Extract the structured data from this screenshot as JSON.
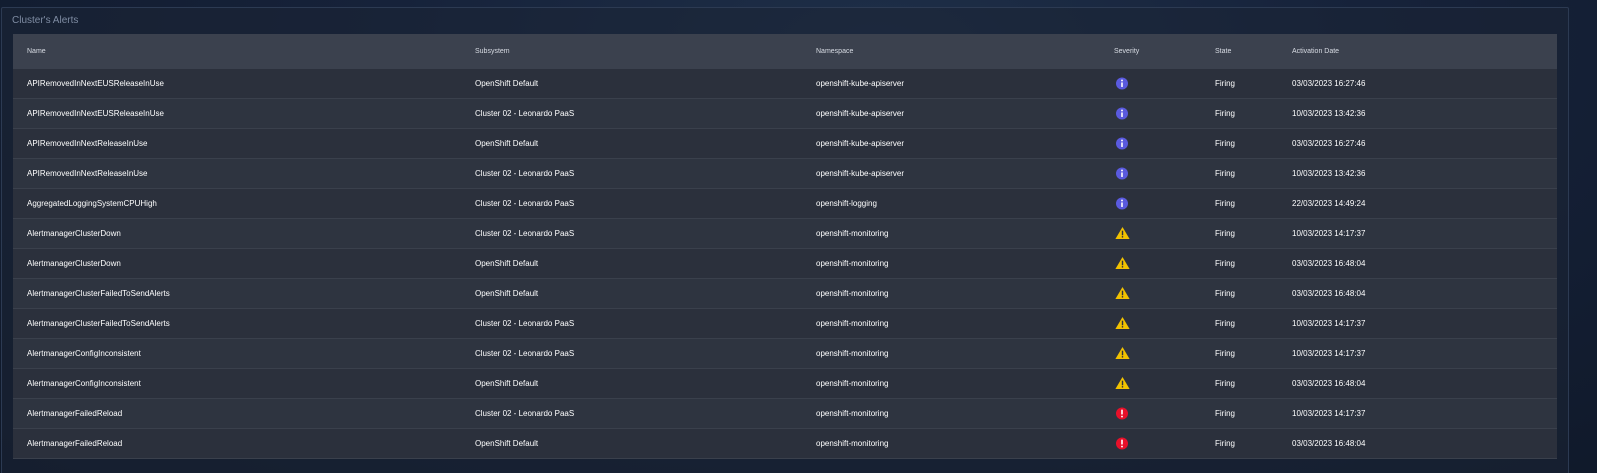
{
  "panel": {
    "title": "Cluster's Alerts"
  },
  "columns": [
    "Name",
    "Subsystem",
    "Namespace",
    "Severity",
    "State",
    "Activation Date"
  ],
  "colors": {
    "info": "#5a5adf",
    "warning": "#f2c200",
    "critical": "#e8102a"
  },
  "rows": [
    {
      "name": "APIRemovedInNextEUSReleaseInUse",
      "subsystem": "OpenShift Default",
      "namespace": "openshift-kube-apiserver",
      "severity": "info",
      "state": "Firing",
      "date": "03/03/2023 16:27:46"
    },
    {
      "name": "APIRemovedInNextEUSReleaseInUse",
      "subsystem": "Cluster 02 - Leonardo PaaS",
      "namespace": "openshift-kube-apiserver",
      "severity": "info",
      "state": "Firing",
      "date": "10/03/2023 13:42:36"
    },
    {
      "name": "APIRemovedInNextReleaseInUse",
      "subsystem": "OpenShift Default",
      "namespace": "openshift-kube-apiserver",
      "severity": "info",
      "state": "Firing",
      "date": "03/03/2023 16:27:46"
    },
    {
      "name": "APIRemovedInNextReleaseInUse",
      "subsystem": "Cluster 02 - Leonardo PaaS",
      "namespace": "openshift-kube-apiserver",
      "severity": "info",
      "state": "Firing",
      "date": "10/03/2023 13:42:36"
    },
    {
      "name": "AggregatedLoggingSystemCPUHigh",
      "subsystem": "Cluster 02 - Leonardo PaaS",
      "namespace": "openshift-logging",
      "severity": "info",
      "state": "Firing",
      "date": "22/03/2023 14:49:24"
    },
    {
      "name": "AlertmanagerClusterDown",
      "subsystem": "Cluster 02 - Leonardo PaaS",
      "namespace": "openshift-monitoring",
      "severity": "warning",
      "state": "Firing",
      "date": "10/03/2023 14:17:37"
    },
    {
      "name": "AlertmanagerClusterDown",
      "subsystem": "OpenShift Default",
      "namespace": "openshift-monitoring",
      "severity": "warning",
      "state": "Firing",
      "date": "03/03/2023 16:48:04"
    },
    {
      "name": "AlertmanagerClusterFailedToSendAlerts",
      "subsystem": "OpenShift Default",
      "namespace": "openshift-monitoring",
      "severity": "warning",
      "state": "Firing",
      "date": "03/03/2023 16:48:04"
    },
    {
      "name": "AlertmanagerClusterFailedToSendAlerts",
      "subsystem": "Cluster 02 - Leonardo PaaS",
      "namespace": "openshift-monitoring",
      "severity": "warning",
      "state": "Firing",
      "date": "10/03/2023 14:17:37"
    },
    {
      "name": "AlertmanagerConfigInconsistent",
      "subsystem": "Cluster 02 - Leonardo PaaS",
      "namespace": "openshift-monitoring",
      "severity": "warning",
      "state": "Firing",
      "date": "10/03/2023 14:17:37"
    },
    {
      "name": "AlertmanagerConfigInconsistent",
      "subsystem": "OpenShift Default",
      "namespace": "openshift-monitoring",
      "severity": "warning",
      "state": "Firing",
      "date": "03/03/2023 16:48:04"
    },
    {
      "name": "AlertmanagerFailedReload",
      "subsystem": "Cluster 02 - Leonardo PaaS",
      "namespace": "openshift-monitoring",
      "severity": "critical",
      "state": "Firing",
      "date": "10/03/2023 14:17:37"
    },
    {
      "name": "AlertmanagerFailedReload",
      "subsystem": "OpenShift Default",
      "namespace": "openshift-monitoring",
      "severity": "critical",
      "state": "Firing",
      "date": "03/03/2023 16:48:04"
    }
  ]
}
